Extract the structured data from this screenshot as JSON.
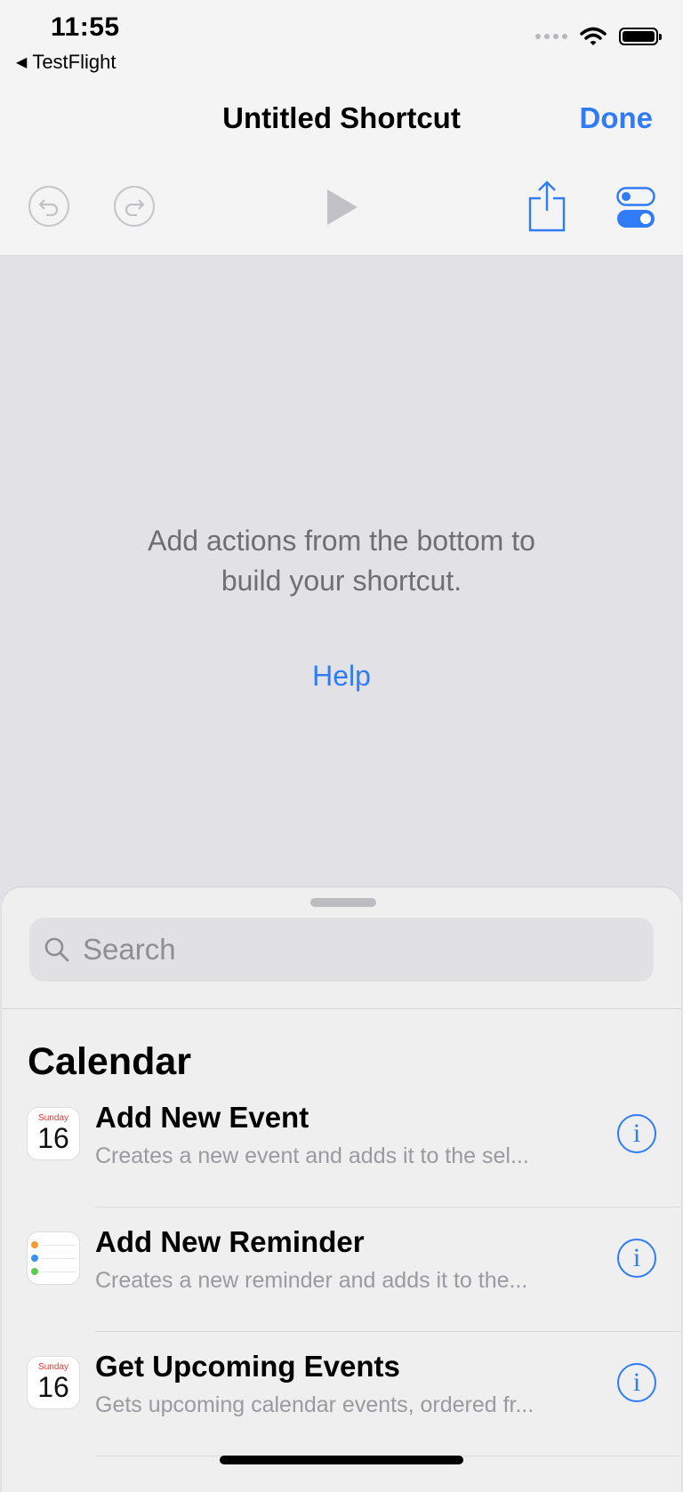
{
  "status_bar": {
    "time": "11:55",
    "back_app": "TestFlight"
  },
  "nav": {
    "title": "Untitled Shortcut",
    "done_label": "Done"
  },
  "editor": {
    "empty_message_line1": "Add actions from the bottom to",
    "empty_message_line2": "build your shortcut.",
    "help_label": "Help"
  },
  "sheet": {
    "search_placeholder": "Search",
    "section_title": "Calendar",
    "actions": [
      {
        "title": "Add New Event",
        "subtitle": "Creates a new event and adds it to the sel...",
        "icon": "calendar-icon",
        "cal_day": "Sunday",
        "cal_num": "16"
      },
      {
        "title": "Add New Reminder",
        "subtitle": "Creates a new reminder and adds it to the...",
        "icon": "reminders-icon"
      },
      {
        "title": "Get Upcoming Events",
        "subtitle": "Gets upcoming calendar events, ordered fr...",
        "icon": "calendar-icon",
        "cal_day": "Sunday",
        "cal_num": "16"
      }
    ]
  },
  "colors": {
    "accent": "#2f7cf6",
    "background": "#e2e2e6",
    "sheet": "#efeff0"
  }
}
